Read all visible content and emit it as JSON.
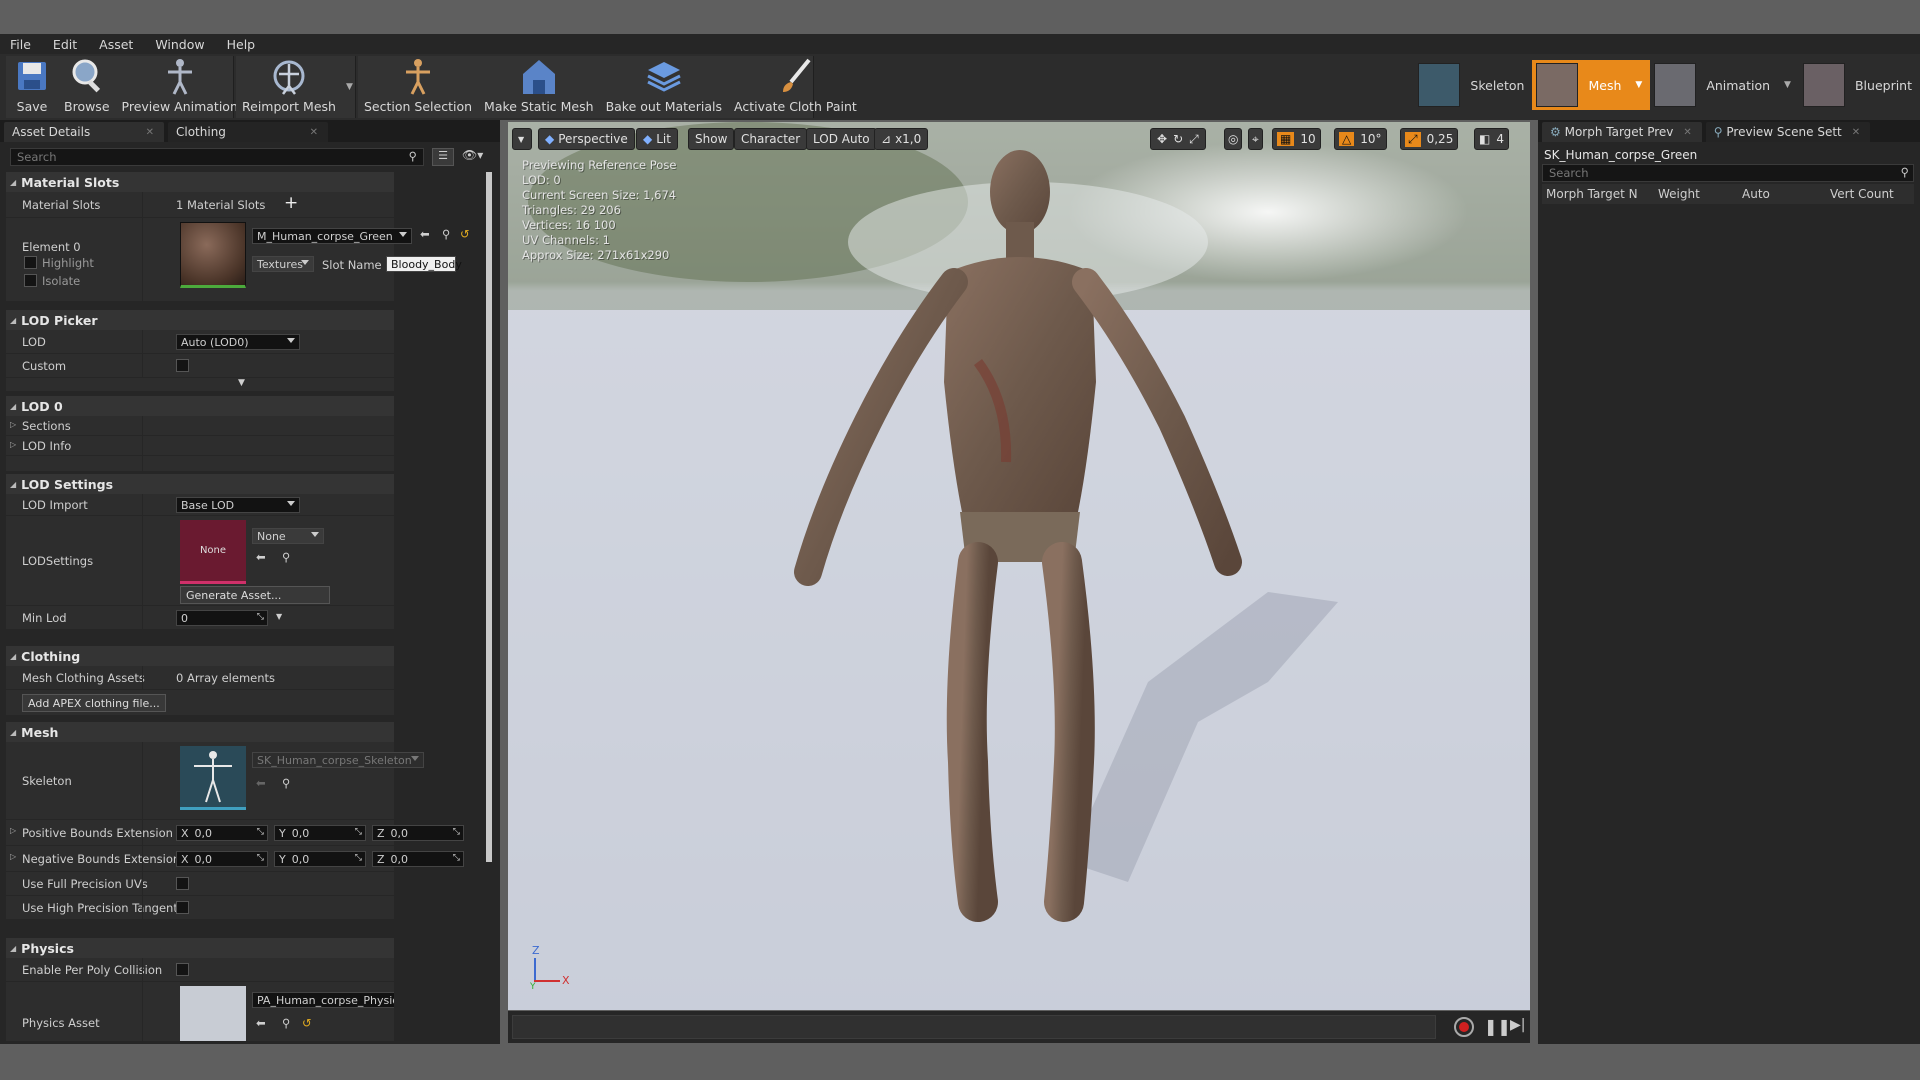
{
  "menu": [
    "File",
    "Edit",
    "Asset",
    "Window",
    "Help"
  ],
  "toolbar": {
    "save": "Save",
    "browse": "Browse",
    "preview_animation": "Preview Animation",
    "reimport_mesh": "Reimport Mesh",
    "section_selection": "Section Selection",
    "make_static_mesh": "Make Static Mesh",
    "bake_out_materials": "Bake out Materials",
    "activate_cloth_paint": "Activate Cloth Paint"
  },
  "modes": {
    "skeleton": "Skeleton",
    "mesh": "Mesh",
    "animation": "Animation",
    "blueprint": "Blueprint",
    "active_color": "#e8891a"
  },
  "left_tabs": [
    "Asset Details",
    "Clothing"
  ],
  "search_placeholder": "Search",
  "details": {
    "material_slots": {
      "header": "Material Slots",
      "label": "Material Slots",
      "value": "1 Material Slots",
      "element": "Element 0",
      "highlight": "Highlight",
      "isolate": "Isolate",
      "material_name": "M_Human_corpse_Green",
      "textures": "Textures",
      "slot_name_label": "Slot Name",
      "slot_name": "Bloody_Body"
    },
    "lod_picker": {
      "header": "LOD Picker",
      "lod_label": "LOD",
      "lod_value": "Auto (LOD0)",
      "custom_label": "Custom"
    },
    "lod0": {
      "header": "LOD 0",
      "sections": "Sections",
      "lod_info": "LOD Info"
    },
    "lod_settings": {
      "header": "LOD Settings",
      "lod_import_label": "LOD Import",
      "lod_import_value": "Base LOD",
      "lodsettings_label": "LODSettings",
      "none_thumb": "None",
      "none_combo": "None",
      "generate_asset": "Generate Asset...",
      "min_lod_label": "Min Lod",
      "min_lod_value": "0"
    },
    "clothing": {
      "header": "Clothing",
      "assets_label": "Mesh Clothing Assets",
      "assets_value": "0 Array elements",
      "add_apex": "Add APEX clothing file..."
    },
    "mesh": {
      "header": "Mesh",
      "skeleton_label": "Skeleton",
      "skeleton_value": "SK_Human_corpse_Skeleton",
      "pos_bounds_label": "Positive Bounds Extension",
      "neg_bounds_label": "Negative Bounds Extension",
      "x_label": "X",
      "y_label": "Y",
      "z_label": "Z",
      "pos_x": "0,0",
      "pos_y": "0,0",
      "pos_z": "0,0",
      "neg_x": "0,0",
      "neg_y": "0,0",
      "neg_z": "0,0",
      "full_precision_uvs": "Use Full Precision UVs",
      "high_precision_tangent": "Use High Precision Tangent B"
    },
    "physics": {
      "header": "Physics",
      "per_poly_label": "Enable Per Poly Collision",
      "physics_asset_label": "Physics Asset",
      "physics_asset_value": "PA_Human_corpse_PhysicsAsset"
    }
  },
  "viewport": {
    "buttons": {
      "perspective": "Perspective",
      "lit": "Lit",
      "show": "Show",
      "character": "Character",
      "lod_auto": "LOD Auto",
      "speed": "x1,0"
    },
    "right_tools": {
      "grid": "10",
      "angle": "10°",
      "scale": "0,25",
      "camera_speed": "4"
    },
    "overlay": [
      "Previewing Reference Pose",
      "LOD: 0",
      "Current Screen Size: 1,674",
      "Triangles: 29 206",
      "Vertices: 16 100",
      "UV Channels: 1",
      "Approx Size: 271x61x290"
    ],
    "axis": {
      "z": "Z",
      "x": "X",
      "y": "Y"
    }
  },
  "right_panel": {
    "tabs": [
      "Morph Target Prev",
      "Preview Scene Sett"
    ],
    "asset_name": "SK_Human_corpse_Green",
    "search_placeholder": "Search",
    "columns": [
      "Morph Target N",
      "Weight",
      "Auto",
      "Vert Count"
    ]
  }
}
